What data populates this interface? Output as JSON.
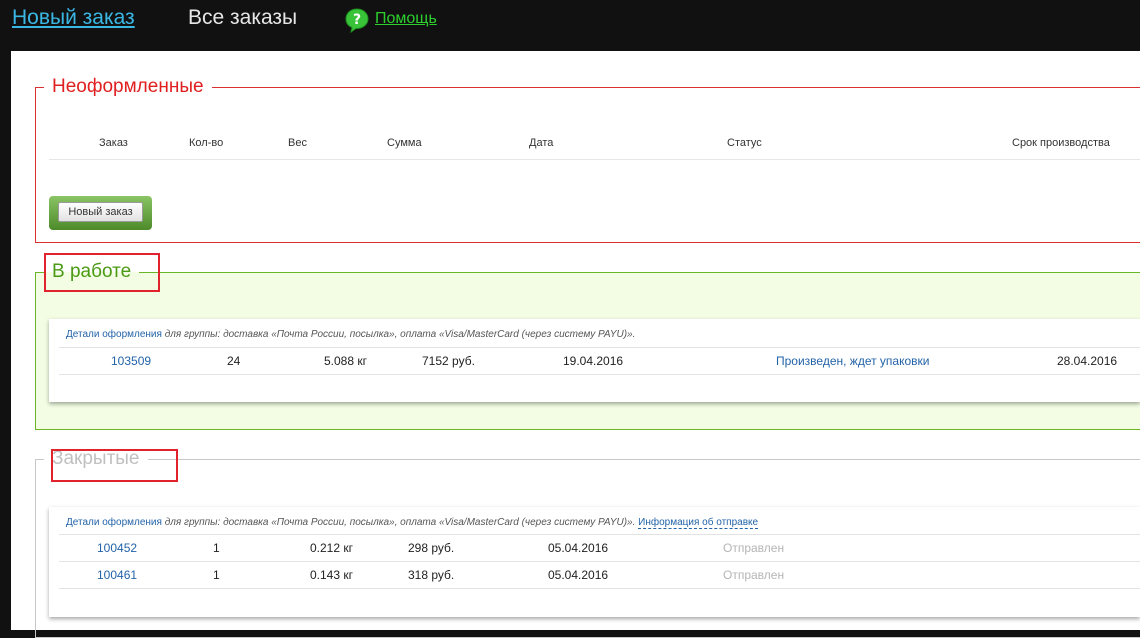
{
  "nav": {
    "new_order": "Новый заказ",
    "all_orders": "Все заказы",
    "help": "Помощь"
  },
  "sections": {
    "draft": {
      "title": "Неоформленные",
      "columns": [
        "Заказ",
        "Кол-во",
        "Вес",
        "Сумма",
        "Дата",
        "Статус",
        "Срок производства"
      ],
      "new_order_button": "Новый заказ"
    },
    "in_work": {
      "title": "В работе",
      "group": {
        "details_link": "Детали оформления",
        "desc": "для группы: доставка «Почта России, посылка», оплата «Visa/MasterCard (через систему PAYU)»."
      },
      "rows": [
        {
          "order": "103509",
          "qty": "24",
          "weight": "5.088 кг",
          "sum": "7152 руб.",
          "date": "19.04.2016",
          "status": "Произведен, ждет упаковки",
          "deadline": "28.04.2016"
        }
      ]
    },
    "closed": {
      "title": "Закрытые",
      "group": {
        "details_link": "Детали оформления",
        "desc": "для группы: доставка «Почта России, посылка», оплата «Visa/MasterCard (через систему PAYU)».",
        "info_link": "Информация об отправке"
      },
      "rows": [
        {
          "order": "100452",
          "qty": "1",
          "weight": "0.212 кг",
          "sum": "298 руб.",
          "date": "05.04.2016",
          "status": "Отправлен"
        },
        {
          "order": "100461",
          "qty": "1",
          "weight": "0.143 кг",
          "sum": "318 руб.",
          "date": "05.04.2016",
          "status": "Отправлен"
        }
      ]
    }
  },
  "colors": {
    "accent_blue": "#3bb7e4",
    "help_green": "#2dcf2d",
    "draft_red": "#e02020",
    "in_work_green": "#4a9a13",
    "highlight_red": "#e0232c"
  }
}
